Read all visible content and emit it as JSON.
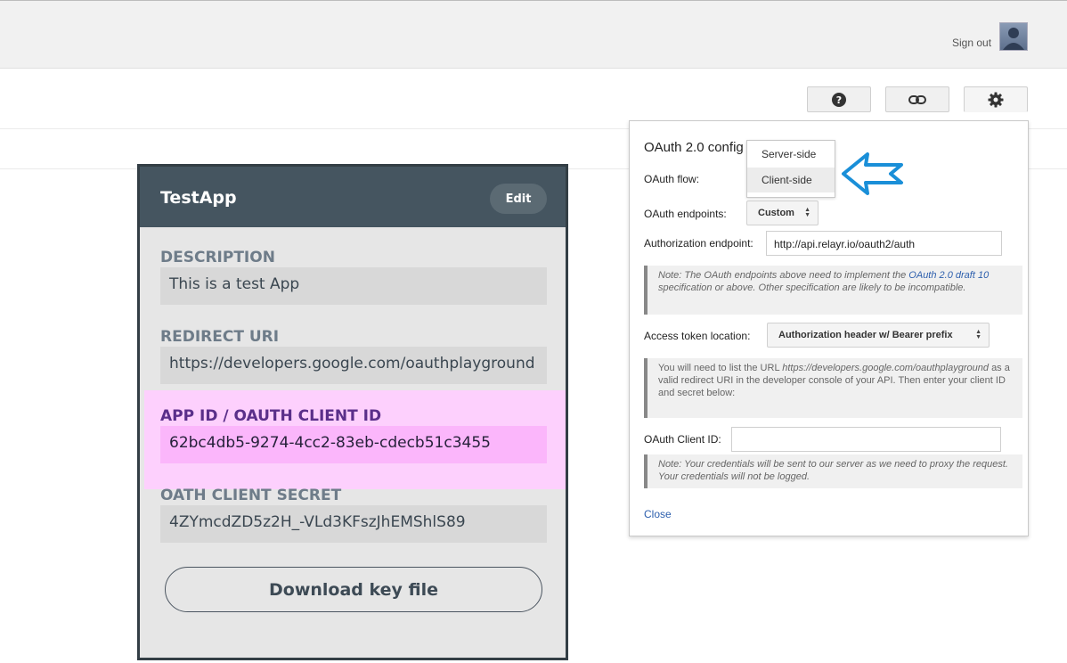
{
  "header": {
    "signout_label": "Sign out",
    "avatar_icon": "user-avatar-icon"
  },
  "toolbar": {
    "help_icon": "help-icon",
    "link_icon": "link-icon",
    "settings_icon": "gear-icon"
  },
  "app_card": {
    "title": "TestApp",
    "edit_label": "Edit",
    "fields": [
      {
        "label": "DESCRIPTION",
        "value": "This is a test App"
      },
      {
        "label": "REDIRECT URI",
        "value": "https://developers.google.com/oauthplayground"
      },
      {
        "label": "APP ID / OAUTH CLIENT ID",
        "value": "62bc4db5-9274-4cc2-83eb-cdecb51c3455"
      },
      {
        "label": "OATH CLIENT SECRET",
        "value": "4ZYmcdZD5z2H_-VLd3KFszJhEMShlS89"
      }
    ],
    "download_label": "Download key file",
    "highlight_color": "#fdd0fd"
  },
  "config_panel": {
    "title": "OAuth 2.0 config",
    "flow_label": "OAuth flow:",
    "flow_options": [
      "Server-side",
      "Client-side"
    ],
    "flow_selected": "Client-side",
    "endpoints_label": "OAuth endpoints:",
    "endpoints_value": "Custom",
    "auth_endpoint_label": "Authorization endpoint:",
    "auth_endpoint_value": "http://api.relayr.io/oauth2/auth",
    "note1_prefix": "Note: The OAuth endpoints above need to implement the",
    "note1_link": "OAuth 2.0 draft 10",
    "note1_suffix": "specification or above. Other specification are likely to be incompatible.",
    "token_location_label": "Access token location:",
    "token_location_value": "Authorization header w/ Bearer prefix",
    "note2_prefix": "You will need to list the URL",
    "note2_url": "https://developers.google.com/oauthplayground",
    "note2_suffix": "as a valid redirect URI in the developer console of your API. Then enter your client ID and secret below:",
    "client_id_label": "OAuth Client ID:",
    "client_id_value": "",
    "note3": "Note: Your credentials will be sent to our server as we need to proxy the request. Your credentials will not be logged.",
    "close_label": "Close"
  },
  "colors": {
    "arrow": "#1a8fd8",
    "card_header": "#455560",
    "link": "#2d5fad"
  }
}
